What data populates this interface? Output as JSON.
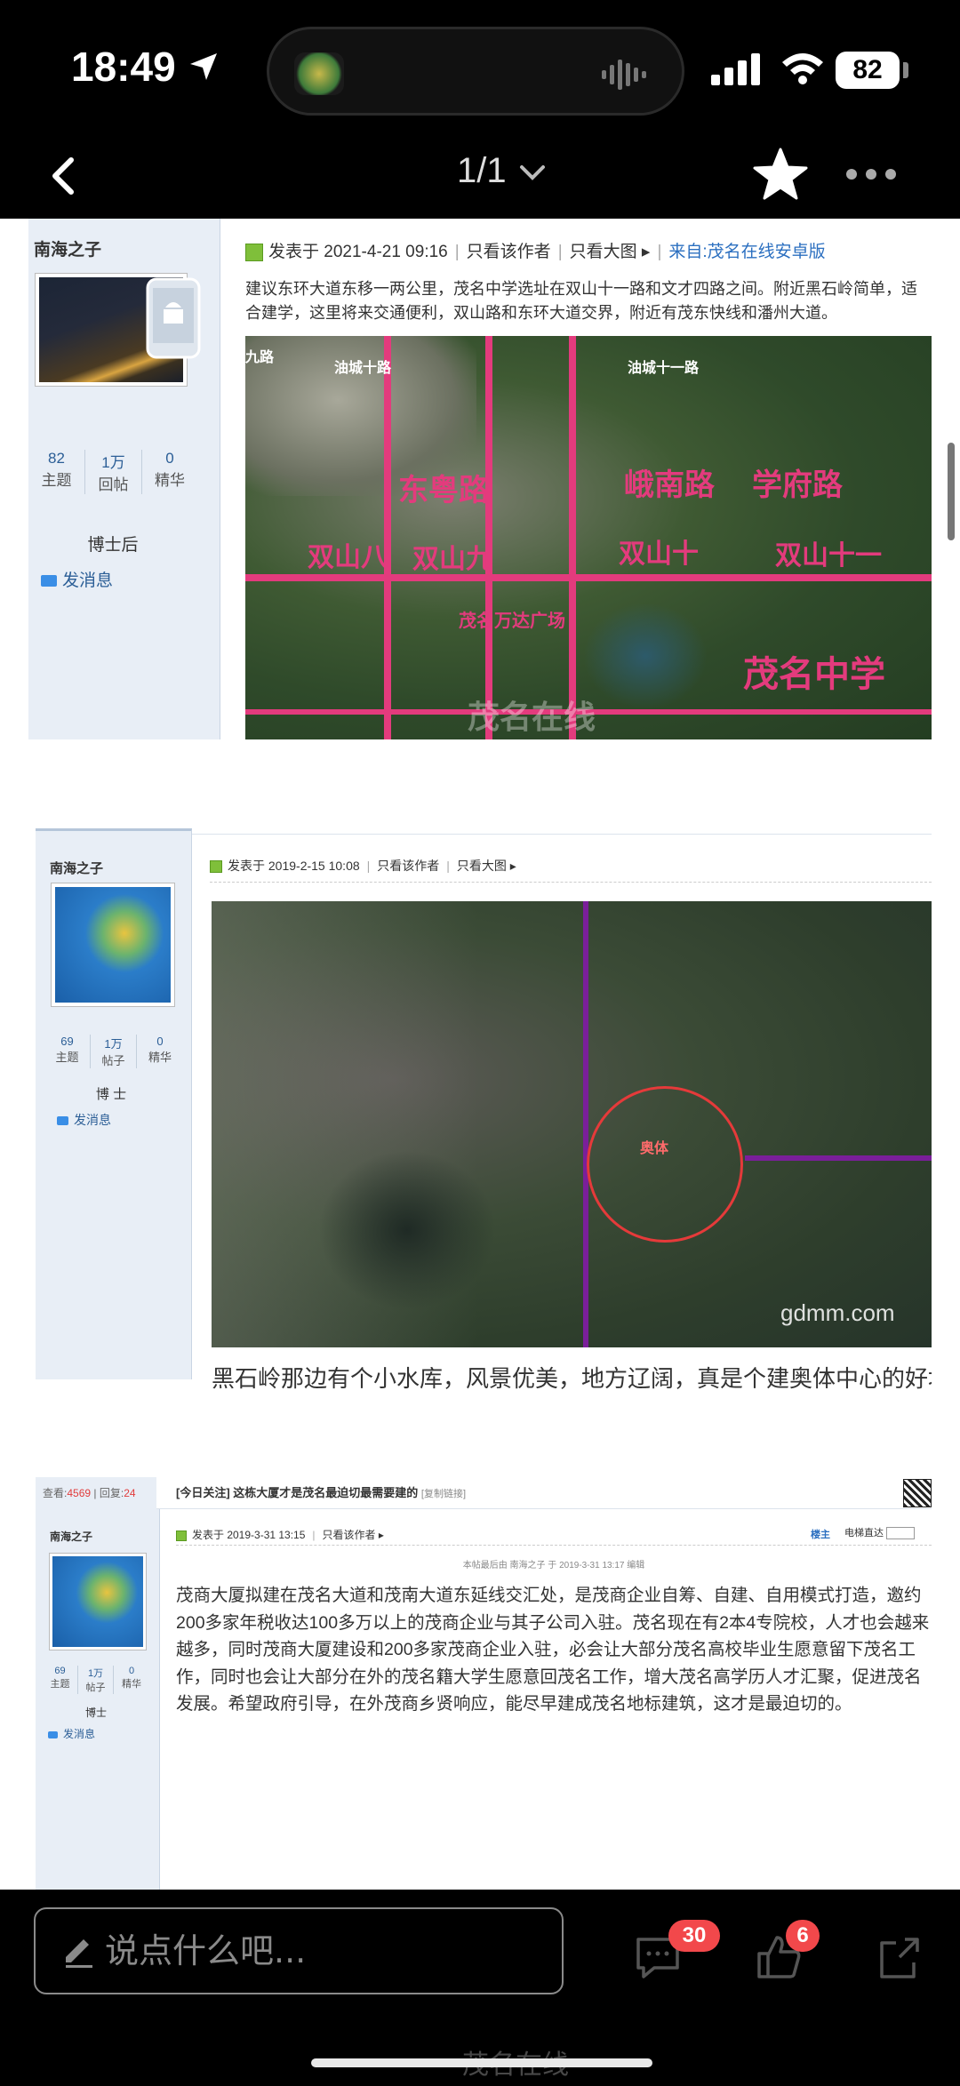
{
  "status_bar": {
    "time": "18:49",
    "battery": "82"
  },
  "nav": {
    "pager": "1/1"
  },
  "posts": [
    {
      "author": "南海之子",
      "stats": [
        {
          "value": "82",
          "label": "主题"
        },
        {
          "value": "1万",
          "label": "回帖"
        },
        {
          "value": "0",
          "label": "精华"
        }
      ],
      "rank": "博士后",
      "send_message": "发消息",
      "posted_at": "发表于 2021-4-21 09:16",
      "only_author": "只看该作者",
      "big_image": "只看大图",
      "source": "来自:茂名在线安卓版",
      "body": "建议东环大道东移一两公里，茂名中学选址在双山十一路和文才四路之间。附近黑石岭简单，适合建学，这里将来交通便利，双山路和东环大道交界，附近有茂东快线和潘州大道。",
      "map_labels": {
        "road_1": "东粤路",
        "road_2": "峨南路",
        "road_3": "学府路",
        "road_4": "双山八",
        "road_5": "双山九",
        "road_6": "双山十",
        "road_7": "双山十一",
        "place_1": "茂名万达广场",
        "place_2": "茂名中学",
        "place_3": "九路",
        "place_4": "油城十路",
        "place_5": "油城十一路",
        "watermark": "茂名在线"
      }
    },
    {
      "author": "南海之子",
      "stats": [
        {
          "value": "69",
          "label": "主题"
        },
        {
          "value": "1万",
          "label": "帖子"
        },
        {
          "value": "0",
          "label": "精华"
        }
      ],
      "rank": "博 士",
      "send_message": "发消息",
      "posted_at": "发表于 2019-2-15 10:08",
      "only_author": "只看该作者",
      "big_image": "只看大图",
      "body": "黑石岭那边有个小水库，风景优美，地方辽阔，真是个建奥体中心的好地方",
      "map_labels": {
        "circle_label": "奥体",
        "watermark": "gdmm.com"
      }
    },
    {
      "header": {
        "views_label": "查看:",
        "views": "4569",
        "replies_label": "回复:",
        "replies": "24",
        "title": "[今日关注] 这栋大厦才是茂名最迫切最需要建的",
        "copy_link": "[复制链接]"
      },
      "author": "南海之子",
      "stats": [
        {
          "value": "69",
          "label": "主题"
        },
        {
          "value": "1万",
          "label": "帖子"
        },
        {
          "value": "0",
          "label": "精华"
        }
      ],
      "rank": "博士",
      "send_message": "发消息",
      "posted_at": "发表于 2019-3-31 13:15",
      "only_author": "只看该作者",
      "floor": "楼主",
      "elevator": "电梯直达",
      "edit_note": "本帖最后由 南海之子 于 2019-3-31 13:17 编辑",
      "body": "茂商大厦拟建在茂名大道和茂南大道东延线交汇处，是茂商企业自筹、自建、自用模式打造，邀约200多家年税收达100多万以上的茂商企业与其子公司入驻。茂名现在有2本4专院校，人才也会越来越多，同时茂商大厦建设和200多家茂商企业入驻，必会让大部分茂名高校毕业生愿意留下茂名工作，同时也会让大部分在外的茂名籍大学生愿意回茂名工作，增大茂名高学历人才汇聚，促进茂名发展。希望政府引导，在外茂商乡贤响应，能尽早建成茂名地标建筑，这才是最迫切的。"
    }
  ],
  "bottom_bar": {
    "comment_placeholder": "说点什么吧...",
    "comments_count": "30",
    "likes_count": "6",
    "watermark": "茂名在线"
  },
  "colors": {
    "road_pink": "#e33b7d",
    "link_blue": "#2b5e96",
    "badge_red": "#f2484b"
  }
}
